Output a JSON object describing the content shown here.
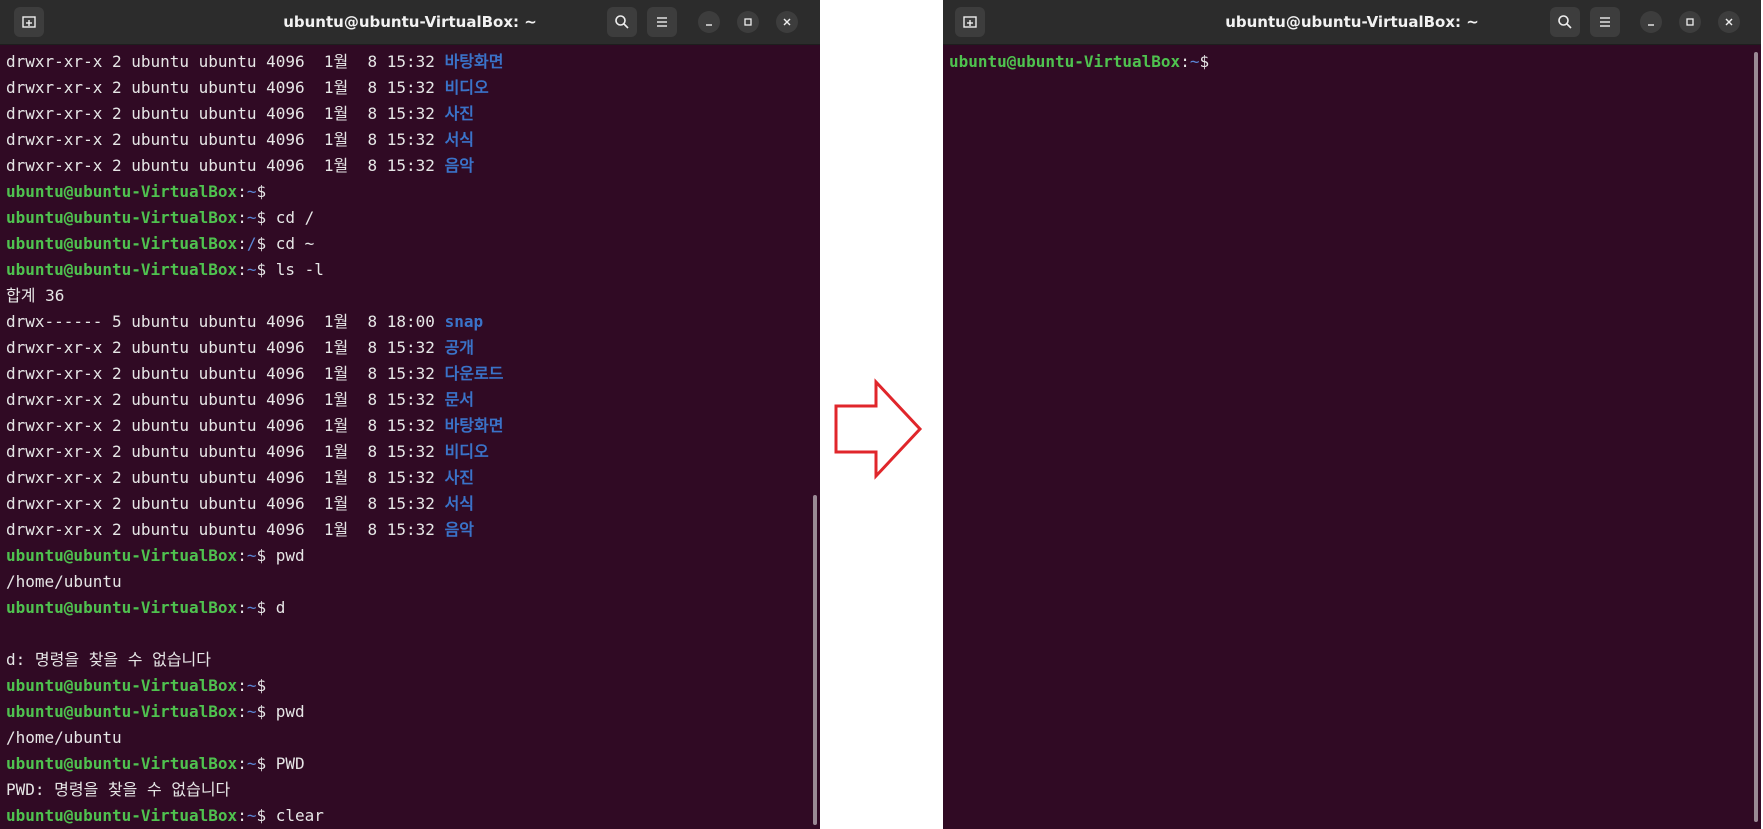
{
  "colors": {
    "terminal_bg": "#300a24",
    "titlebar_bg": "#2c2c2c",
    "prompt_user": "#4fc24f",
    "prompt_path": "#5b87d6",
    "directory": "#3a73c9",
    "arrow": "#e0262b"
  },
  "left_window": {
    "title": "ubuntu@ubuntu-VirtualBox: ~",
    "icons": [
      "new-tab-icon",
      "search-icon",
      "hamburger-menu-icon",
      "minimize-icon",
      "maximize-icon",
      "close-icon"
    ],
    "lines": [
      {
        "type": "entry",
        "perm": "drwxr-xr-x 2 ubuntu ubuntu 4096  1월  8 15:32 ",
        "name": "바탕화면"
      },
      {
        "type": "entry",
        "perm": "drwxr-xr-x 2 ubuntu ubuntu 4096  1월  8 15:32 ",
        "name": "비디오"
      },
      {
        "type": "entry",
        "perm": "drwxr-xr-x 2 ubuntu ubuntu 4096  1월  8 15:32 ",
        "name": "사진"
      },
      {
        "type": "entry",
        "perm": "drwxr-xr-x 2 ubuntu ubuntu 4096  1월  8 15:32 ",
        "name": "서식"
      },
      {
        "type": "entry",
        "perm": "drwxr-xr-x 2 ubuntu ubuntu 4096  1월  8 15:32 ",
        "name": "음악"
      },
      {
        "type": "prompt",
        "user": "ubuntu@ubuntu-VirtualBox",
        "path": "~",
        "cmd": ""
      },
      {
        "type": "prompt",
        "user": "ubuntu@ubuntu-VirtualBox",
        "path": "~",
        "cmd": " cd /"
      },
      {
        "type": "prompt",
        "user": "ubuntu@ubuntu-VirtualBox",
        "path": "/",
        "cmd": " cd ~"
      },
      {
        "type": "prompt",
        "user": "ubuntu@ubuntu-VirtualBox",
        "path": "~",
        "cmd": " ls -l"
      },
      {
        "type": "text",
        "text": "합계 36"
      },
      {
        "type": "entry",
        "perm": "drwx------ 5 ubuntu ubuntu 4096  1월  8 18:00 ",
        "name": "snap"
      },
      {
        "type": "entry",
        "perm": "drwxr-xr-x 2 ubuntu ubuntu 4096  1월  8 15:32 ",
        "name": "공개"
      },
      {
        "type": "entry",
        "perm": "drwxr-xr-x 2 ubuntu ubuntu 4096  1월  8 15:32 ",
        "name": "다운로드"
      },
      {
        "type": "entry",
        "perm": "drwxr-xr-x 2 ubuntu ubuntu 4096  1월  8 15:32 ",
        "name": "문서"
      },
      {
        "type": "entry",
        "perm": "drwxr-xr-x 2 ubuntu ubuntu 4096  1월  8 15:32 ",
        "name": "바탕화면"
      },
      {
        "type": "entry",
        "perm": "drwxr-xr-x 2 ubuntu ubuntu 4096  1월  8 15:32 ",
        "name": "비디오"
      },
      {
        "type": "entry",
        "perm": "drwxr-xr-x 2 ubuntu ubuntu 4096  1월  8 15:32 ",
        "name": "사진"
      },
      {
        "type": "entry",
        "perm": "drwxr-xr-x 2 ubuntu ubuntu 4096  1월  8 15:32 ",
        "name": "서식"
      },
      {
        "type": "entry",
        "perm": "drwxr-xr-x 2 ubuntu ubuntu 4096  1월  8 15:32 ",
        "name": "음악"
      },
      {
        "type": "prompt",
        "user": "ubuntu@ubuntu-VirtualBox",
        "path": "~",
        "cmd": " pwd"
      },
      {
        "type": "text",
        "text": "/home/ubuntu"
      },
      {
        "type": "prompt",
        "user": "ubuntu@ubuntu-VirtualBox",
        "path": "~",
        "cmd": " d"
      },
      {
        "type": "text",
        "text": ""
      },
      {
        "type": "text",
        "text": "d: 명령을 찾을 수 없습니다"
      },
      {
        "type": "prompt",
        "user": "ubuntu@ubuntu-VirtualBox",
        "path": "~",
        "cmd": ""
      },
      {
        "type": "prompt",
        "user": "ubuntu@ubuntu-VirtualBox",
        "path": "~",
        "cmd": " pwd"
      },
      {
        "type": "text",
        "text": "/home/ubuntu"
      },
      {
        "type": "prompt",
        "user": "ubuntu@ubuntu-VirtualBox",
        "path": "~",
        "cmd": " PWD"
      },
      {
        "type": "text",
        "text": "PWD: 명령을 찾을 수 없습니다"
      },
      {
        "type": "prompt",
        "user": "ubuntu@ubuntu-VirtualBox",
        "path": "~",
        "cmd": " clear"
      }
    ]
  },
  "arrow_icon": "right-arrow-icon",
  "right_window": {
    "title": "ubuntu@ubuntu-VirtualBox: ~",
    "icons": [
      "new-tab-icon",
      "search-icon",
      "hamburger-menu-icon",
      "minimize-icon",
      "maximize-icon",
      "close-icon"
    ],
    "lines": [
      {
        "type": "prompt",
        "user": "ubuntu@ubuntu-VirtualBox",
        "path": "~",
        "cmd": ""
      }
    ]
  }
}
